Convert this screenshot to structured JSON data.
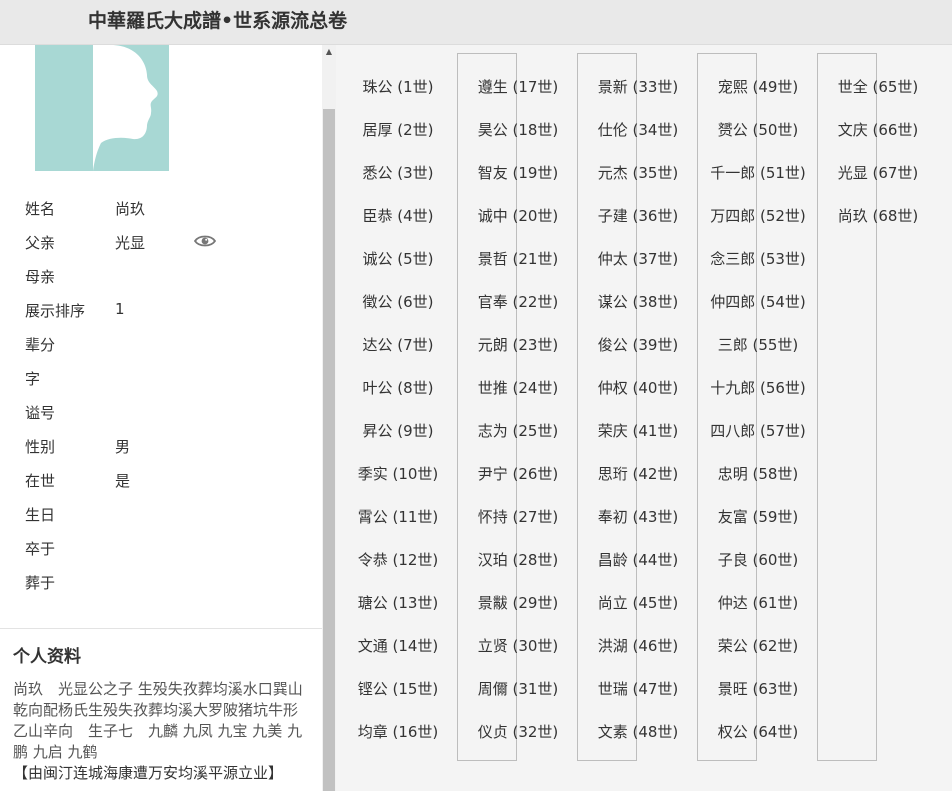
{
  "header": {
    "title": "中華羅氏大成譜•世系源流总卷"
  },
  "person": {
    "rows": [
      {
        "label": "姓名",
        "value": "尚玖"
      },
      {
        "label": "父亲",
        "value": "光显"
      },
      {
        "label": "母亲",
        "value": ""
      },
      {
        "label": "展示排序",
        "value": "1"
      },
      {
        "label": "辈分",
        "value": ""
      },
      {
        "label": "字",
        "value": ""
      },
      {
        "label": "谥号",
        "value": ""
      },
      {
        "label": "性别",
        "value": "男"
      },
      {
        "label": "在世",
        "value": "是"
      },
      {
        "label": "生日",
        "value": ""
      },
      {
        "label": "卒于",
        "value": ""
      },
      {
        "label": "葬于",
        "value": ""
      }
    ]
  },
  "profile": {
    "title": "个人资料",
    "bio": "尚玖　光显公之子 生殁失孜葬均溪水口巽山乾向配杨氏生殁失孜葬均溪大罗陂猪坑牛形乙山辛向　生子七　九麟 九凤 九宝 九美 九鹏 九启 九鹤",
    "source": "【由闽汀连城海康遭万安均溪平源立业】"
  },
  "generations": [
    "珠公 (1世)",
    "居厚 (2世)",
    "悉公 (3世)",
    "臣恭 (4世)",
    "诚公 (5世)",
    "徵公 (6世)",
    "达公 (7世)",
    "叶公 (8世)",
    "昇公 (9世)",
    "季实 (10世)",
    "霄公 (11世)",
    "令恭 (12世)",
    "瑭公 (13世)",
    "文通 (14世)",
    "铿公 (15世)",
    "均章 (16世)",
    "遵生 (17世)",
    "昊公 (18世)",
    "智友 (19世)",
    "诚中 (20世)",
    "景哲 (21世)",
    "官奉 (22世)",
    "元朗 (23世)",
    "世推 (24世)",
    "志为 (25世)",
    "尹宁 (26世)",
    "怀持 (27世)",
    "汉珀 (28世)",
    "景黻 (29世)",
    "立贤 (30世)",
    "周儞 (31世)",
    "仪贞 (32世)",
    "景新 (33世)",
    "仕伦 (34世)",
    "元杰 (35世)",
    "子建 (36世)",
    "仲太 (37世)",
    "谋公 (38世)",
    "俊公 (39世)",
    "仲权 (40世)",
    "荣庆 (41世)",
    "思珩 (42世)",
    "奉初 (43世)",
    "昌龄 (44世)",
    "尚立 (45世)",
    "洪湖 (46世)",
    "世瑞 (47世)",
    "文素 (48世)",
    "宠熙 (49世)",
    "赟公 (50世)",
    "千一郎 (51世)",
    "万四郎 (52世)",
    "念三郎 (53世)",
    "仲四郎 (54世)",
    "三郎 (55世)",
    "十九郎 (56世)",
    "四八郎 (57世)",
    "忠明 (58世)",
    "友富 (59世)",
    "子良 (60世)",
    "仲达 (61世)",
    "荣公 (62世)",
    "景旺 (63世)",
    "权公 (64世)",
    "世全 (65世)",
    "文庆 (66世)",
    "光显 (67世)",
    "尚玖 (68世)"
  ]
}
